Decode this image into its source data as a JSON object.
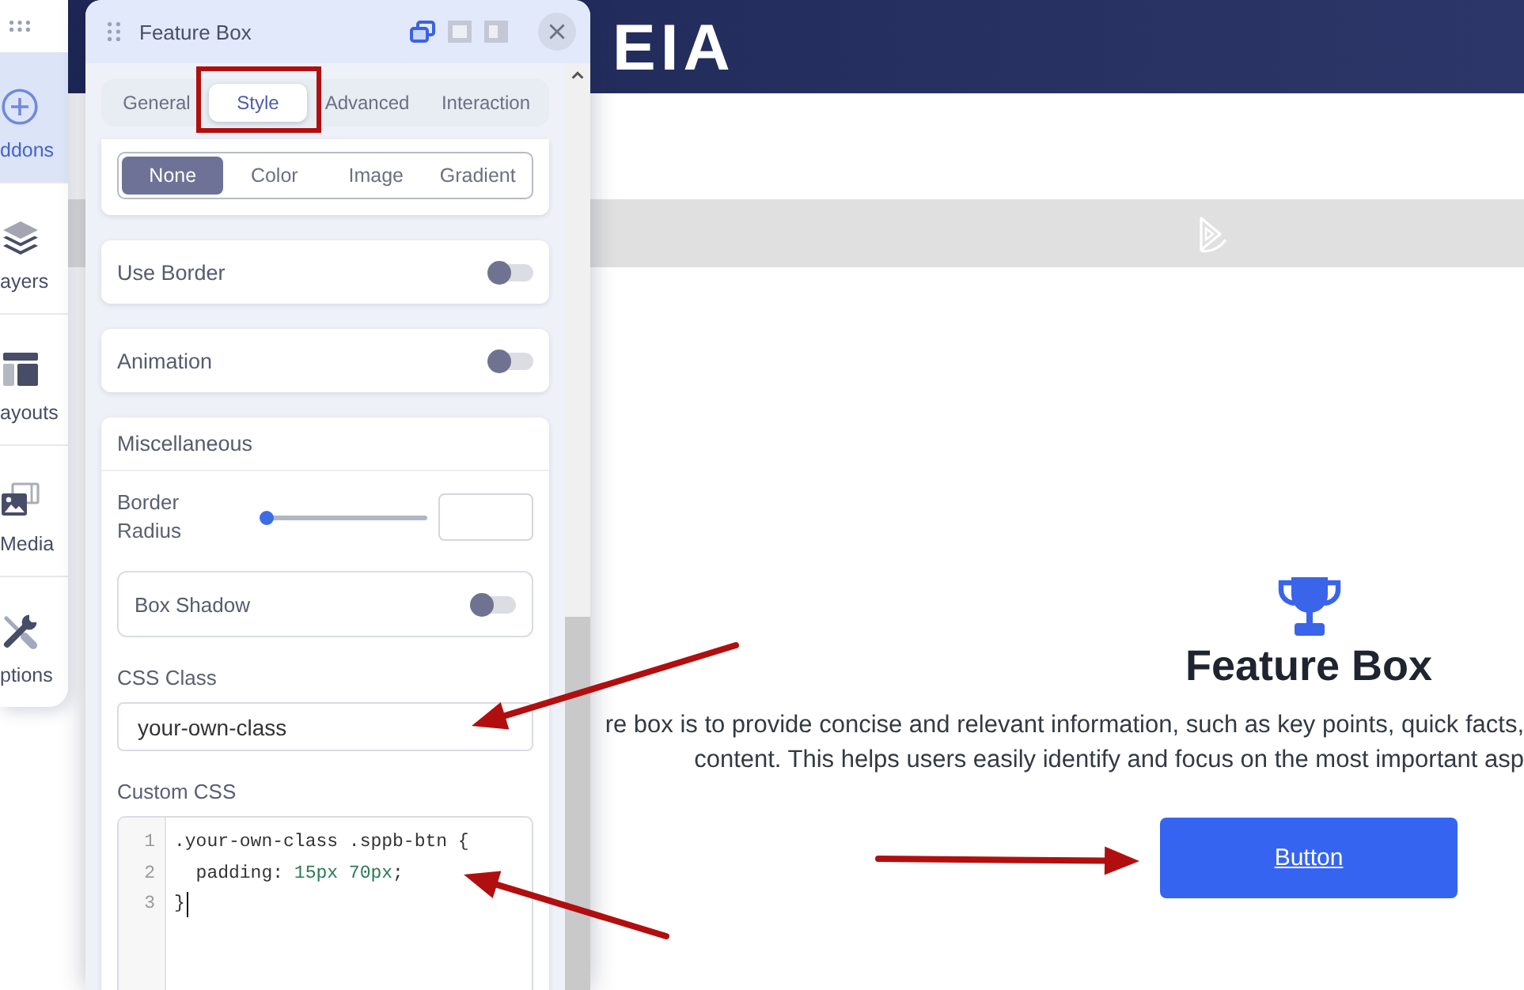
{
  "site": {
    "logo": "EIA",
    "feature": {
      "title": "Feature Box",
      "description_lines": [
        "re box is to provide concise and relevant information, such as key points, quick facts,",
        "content. This helps users easily identify and focus on the most important asp"
      ],
      "button": "Button"
    }
  },
  "sidebar": {
    "items": [
      {
        "label": "ddons",
        "selected": true
      },
      {
        "label": "ayers",
        "selected": false
      },
      {
        "label": "ayouts",
        "selected": false
      },
      {
        "label": "Media",
        "selected": false
      },
      {
        "label": "ptions",
        "selected": false
      }
    ]
  },
  "panel": {
    "title": "Feature Box",
    "tabs": [
      {
        "label": "General",
        "selected": false
      },
      {
        "label": "Style",
        "selected": true
      },
      {
        "label": "Advanced",
        "selected": false
      },
      {
        "label": "Interaction",
        "selected": false
      }
    ],
    "background_types": [
      {
        "label": "None",
        "selected": true
      },
      {
        "label": "Color",
        "selected": false
      },
      {
        "label": "Image",
        "selected": false
      },
      {
        "label": "Gradient",
        "selected": false
      }
    ],
    "toggles": [
      {
        "label": "Use Border",
        "on": false
      },
      {
        "label": "Animation",
        "on": false
      }
    ],
    "miscellaneous": {
      "title": "Miscellaneous",
      "border_radius": {
        "label": "Border Radius",
        "level": 0
      },
      "box_shadow": {
        "label": "Box Shadow",
        "on": false
      },
      "css_class": {
        "label": "CSS Class",
        "value": "your-own-class"
      },
      "custom_css": {
        "label": "Custom CSS",
        "lines": [
          {
            "number": "1",
            "cursor": false,
            "tokens": [
              {
                "kind": "plain",
                "text": ".your-own-class .sppb-btn {"
              }
            ]
          },
          {
            "number": "2",
            "cursor": false,
            "tokens": [
              {
                "kind": "plain",
                "text": "  padding: "
              },
              {
                "kind": "number",
                "text": "15px 70px"
              },
              {
                "kind": "plain",
                "text": ";"
              }
            ]
          },
          {
            "number": "3",
            "cursor": true,
            "tokens": [
              {
                "kind": "plain",
                "text": "}"
              }
            ]
          }
        ]
      }
    }
  }
}
